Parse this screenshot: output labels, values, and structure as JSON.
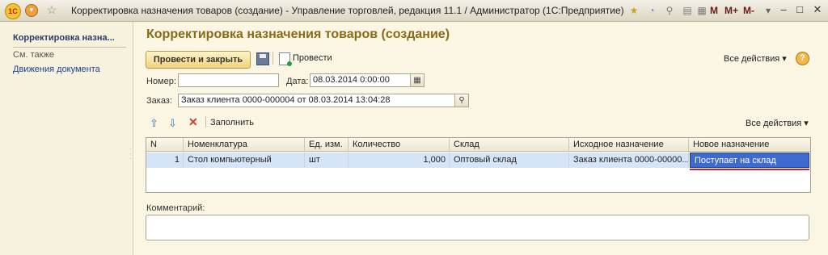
{
  "window": {
    "title": "Корректировка назначения товаров (создание) - Управление торговлей, редакция 11.1 / Администратор  (1С:Предприятие)",
    "logo": "1С",
    "m_buttons": [
      "M",
      "M+",
      "M-"
    ],
    "controls": {
      "minimize": "–",
      "restore": "□",
      "close": "✕"
    }
  },
  "sidebar": {
    "title": "Корректировка назна...",
    "see_also": "См. также",
    "links": [
      "Движения документа"
    ]
  },
  "form": {
    "title": "Корректировка назначения товаров (создание)",
    "primary_button": "Провести и закрыть",
    "post_button": "Провести",
    "all_actions": "Все действия ▾",
    "help": "?",
    "number_label": "Номер:",
    "number_value": "",
    "date_label": "Дата:",
    "date_value": "08.03.2014  0:00:00",
    "order_label": "Заказ:",
    "order_value": "Заказ клиента 0000-000004 от 08.03.2014 13:04:28"
  },
  "table_toolbar": {
    "fill_label": "Заполнить",
    "all_actions": "Все действия ▾"
  },
  "table": {
    "columns": [
      "N",
      "Номенклатура",
      "Ед. изм.",
      "Количество",
      "Склад",
      "Исходное назначение",
      "Новое назначение"
    ],
    "rows": [
      [
        "1",
        "Стол компьютерный",
        "шт",
        "1,000",
        "Оптовый склад",
        "Заказ клиента 0000-00000...",
        "Поступает на склад"
      ]
    ]
  },
  "comment": {
    "label": "Комментарий:",
    "value": ""
  },
  "colors": {
    "background": "#fbf6e3",
    "title": "#8a6a16",
    "selected_row": "#d6e4f7",
    "active_cell": "#3f6bd0",
    "underline": "#c21d2a"
  }
}
